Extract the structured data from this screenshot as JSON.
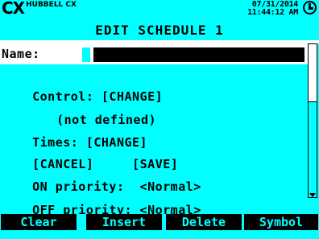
{
  "header": {
    "brand_logo": "CX",
    "brand_text": "HUBBELL CX",
    "date": "07/31/2014",
    "time": "11:44:12 AM",
    "icon": "clock-icon"
  },
  "title": "EDIT SCHEDULE 1",
  "form": {
    "name_label": "Name:",
    "name_value": "",
    "control": "Control: [CHANGE]",
    "control_value": "(not defined)",
    "times": "Times: [CHANGE]",
    "cancel": "[CANCEL]",
    "save": "[SAVE]",
    "on_priority": "ON priority:  <Normal>",
    "off_priority": "OFF priority: <Normal>"
  },
  "softkeys": [
    "Clear",
    "Insert",
    "Delete",
    "Symbol"
  ],
  "colors": {
    "background": "#00ffff",
    "highlight": "#ffffff",
    "text": "#000000"
  }
}
